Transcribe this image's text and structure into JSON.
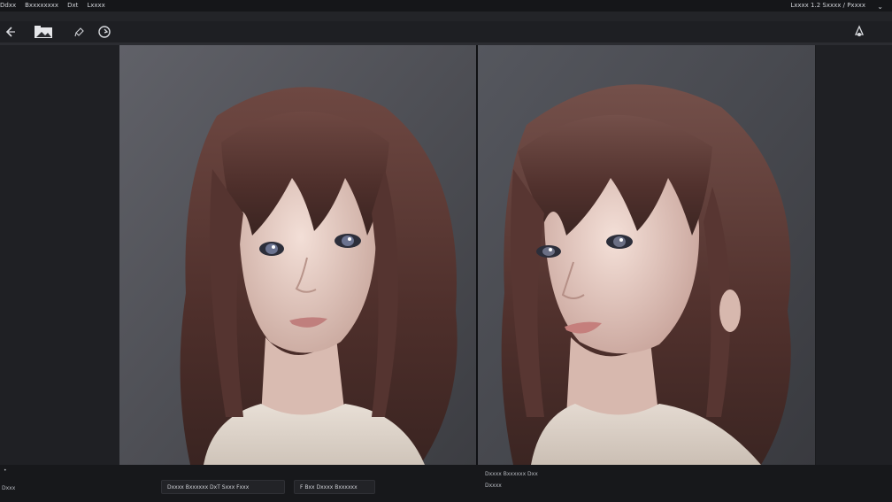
{
  "menubar": {
    "items": [
      "Ddxx",
      "Bxxxxxxxx",
      "Dxt",
      "Lxxxx"
    ],
    "right_text": "Lxxxx 1.2 Sxxxx / Pxxxx"
  },
  "toolbar": {
    "icons": [
      "back-arrow-icon",
      "image-icon",
      "pen-icon",
      "refresh-icon",
      "share-icon"
    ]
  },
  "footer": {
    "status_left": "•",
    "status_left2": "Dxxx",
    "chip1": "Dxxxx Bxxxxxx DxT Sxxx Fxxx",
    "chip2": "F Bxx Dxxxx Bxxxxxx",
    "right_line1": "Dxxxx Bxxxxxx Dxx",
    "right_line2": "Dxxxx"
  },
  "colors": {
    "bg": "#1b1c1f",
    "canvas_bg": "#505259",
    "hair": "#5a3a34"
  }
}
